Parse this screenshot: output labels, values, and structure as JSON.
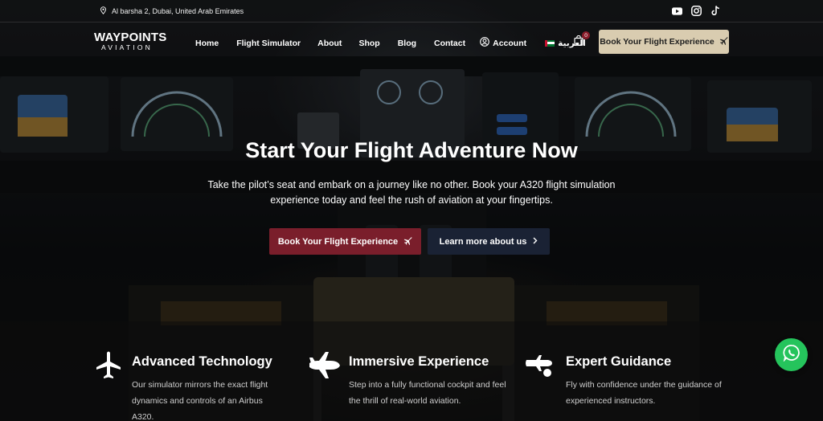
{
  "topbar": {
    "location": "Al barsha 2, Dubai, United Arab Emirates",
    "socials": [
      "youtube-icon",
      "instagram-icon",
      "tiktok-icon"
    ]
  },
  "logo": {
    "line1": "WAYPOINTS",
    "line2": "AVIATION"
  },
  "nav": {
    "items": [
      "Home",
      "Flight Simulator",
      "About",
      "Shop",
      "Blog",
      "Contact"
    ],
    "account": "Account",
    "language": "العربية",
    "cart_count": "0",
    "cta": "Book Your Flight Experience"
  },
  "hero": {
    "title": "Start Your Flight Adventure Now",
    "subtitle": "Take the pilot’s seat and embark on a journey like no other. Book your A320 flight simulation experience today and feel the rush of aviation at your fingertips.",
    "primary_button": "Book Your Flight Experience",
    "secondary_button": "Learn more about us"
  },
  "features": [
    {
      "title": "Advanced Technology",
      "description": "Our simulator mirrors the exact flight dynamics and controls of an Airbus A320.",
      "icon": "airplane-top-icon"
    },
    {
      "title": "Immersive Experience",
      "description": "Step into a fully functional cockpit and feel the thrill of real-world aviation.",
      "icon": "airplane-side-icon"
    },
    {
      "title": "Expert Guidance",
      "description": "Fly with confidence under the guidance of experienced instructors.",
      "icon": "pilot-guidance-icon"
    }
  ],
  "colors": {
    "primary": "#7a1e2b",
    "secondary": "#1a2234",
    "nav_cta": "#d9ccb0",
    "whatsapp": "#25c45c"
  }
}
